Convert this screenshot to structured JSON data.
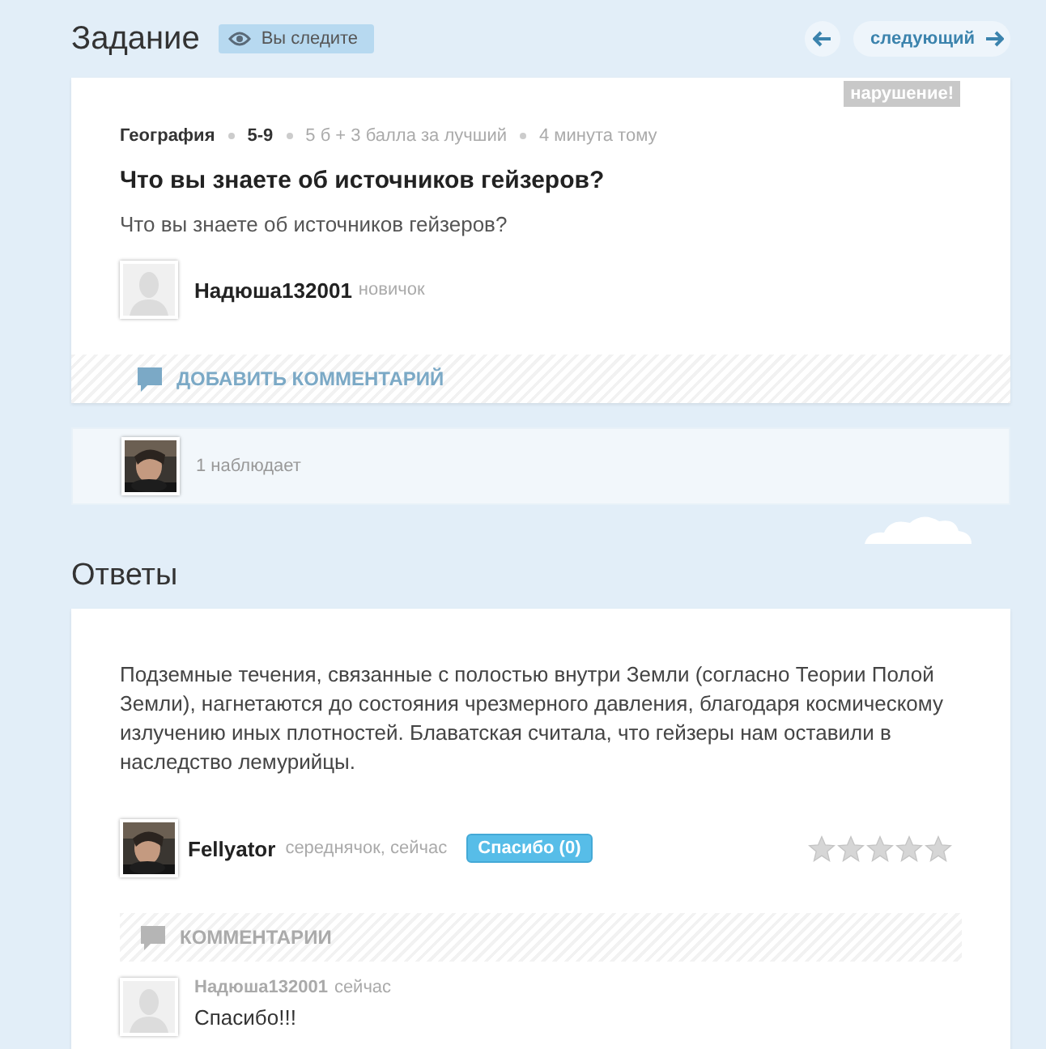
{
  "header": {
    "title": "Задание",
    "follow_badge": "Вы следите",
    "next_label": "следующий"
  },
  "question": {
    "report_tag": "нарушение!",
    "subject": "География",
    "grade": "5-9",
    "points": "5 б + 3 балла за лучший",
    "time": "4 минута тому",
    "title": "Что вы знаете об источников гейзеров?",
    "body": "Что вы знаете об источников гейзеров?",
    "author": {
      "avatar": {
        "kind": "placeholder"
      },
      "name": "Надюша132001",
      "rank": "новичок"
    },
    "add_comment": "ДОБАВИТЬ КОММЕНТАРИЙ"
  },
  "watchers": {
    "label": "1 наблюдает"
  },
  "answers_title": "Ответы",
  "answers": [
    {
      "text": "Подземные течения, связанные с полостью внутри Земли (согласно Теории Полой Земли), нагнетаются до состояния чрезмерного давления, благодаря космическому излучению иных плотностей. Блаватская считала, что гейзеры нам оставили в наследство лемурийцы.",
      "author": {
        "name": "Fellyator",
        "meta": "середнячок, сейчас"
      },
      "thanks_button": "Спасибо (0)",
      "stars": 0,
      "comments_title": "КОММЕНТАРИИ",
      "comments": [
        {
          "avatar": {
            "kind": "placeholder"
          },
          "author": "Надюша132001",
          "time": "сейчас",
          "text": "Спасибо!!!"
        }
      ]
    }
  ]
}
